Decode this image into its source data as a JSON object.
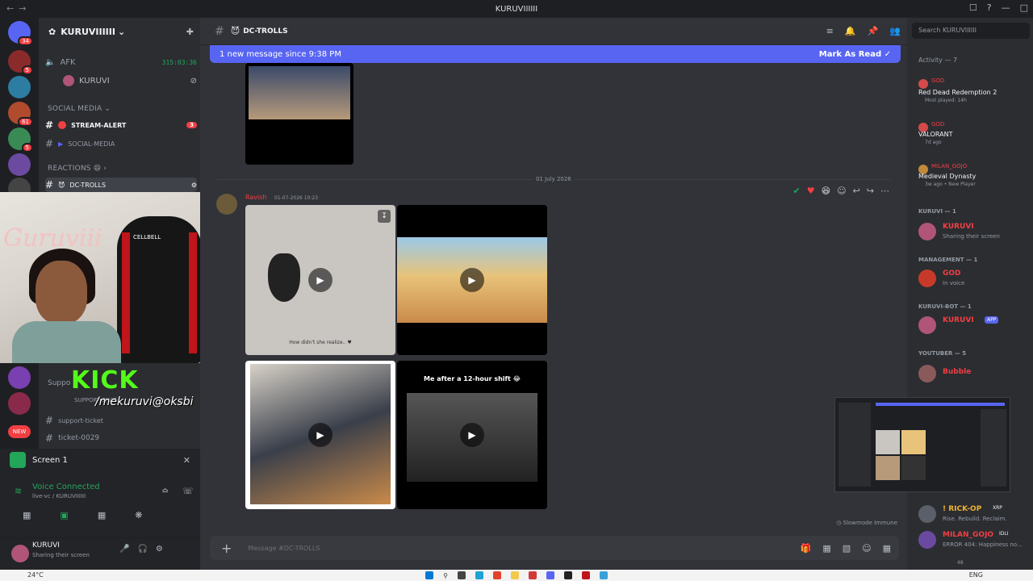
{
  "window": {
    "title": "KURUVIIIIII"
  },
  "guilds": {
    "badges": [
      "34",
      "5",
      "61",
      "5",
      "NEW"
    ]
  },
  "server": {
    "name": "KURUVIIIIII"
  },
  "channels": {
    "afk": {
      "name": "AFK",
      "timer": "315:03:36"
    },
    "voice_user": "KURUVI",
    "cat_social": "SOCIAL MEDIA",
    "stream_alert": "STREAM-ALERT",
    "stream_alert_badge": "3",
    "social_media": "SOCIAL-MEDIA",
    "cat_reactions": "REACTIONS",
    "dc_trolls": "DC-TROLLS",
    "support_cat": "Suppo",
    "support_chat": "SUPPORT-CHAT",
    "support_ticket": "support-ticket",
    "ticket": "ticket-0029"
  },
  "overlay": {
    "kick": "KICK",
    "kick_handle": "/mekuruvi@oksbi",
    "webcam_sign": "Guruviii",
    "chair_brand": "CELLBELL"
  },
  "voice": {
    "screen_label": "Screen 1",
    "status": "Voice Connected",
    "channel": "live-vc / KURUVIIIIII"
  },
  "user": {
    "name": "KURUVI",
    "status": "Sharing their screen"
  },
  "chat": {
    "channel": "DC-TROLLS",
    "banner_text": "1 new message since 9:38 PM",
    "mark_read": "Mark As Read",
    "date_divider": "01 July 2026",
    "author": "Ravish",
    "timestamp": "01-07-2026 10:23",
    "caption1": "How didn't she realize.. ♥",
    "caption4": "Me after a 12-hour shift 😂",
    "slowmode": "Slowmode Immune",
    "composer_placeholder": "Message #DC-TROLLS"
  },
  "members": {
    "search_placeholder": "Search KURUVIIIIII",
    "activity_header": "Activity — 7",
    "activities": [
      {
        "user": "GOD",
        "game": "Red Dead Redemption 2",
        "detail": "Most played: 14h"
      },
      {
        "user": "GOD",
        "game": "VALORANT",
        "detail": "7d ago"
      },
      {
        "user": "MILAN_GOJO",
        "game": "Medieval Dynasty",
        "detail": "3w ago • New Player"
      }
    ],
    "groups": [
      {
        "header": "KURUVI — 1",
        "name": "KURUVI",
        "sub": "Sharing their screen"
      },
      {
        "header": "MANAGEMENT — 1",
        "name": "GOD",
        "sub": "In voice"
      },
      {
        "header": "KURUVI-BOT — 1",
        "name": "KURUVI",
        "sub": "",
        "tag": "APP"
      },
      {
        "header": "YOUTUBER — 5",
        "name": "Bubble",
        "sub": ""
      }
    ],
    "bottom": [
      {
        "name": "! RICK-OP",
        "tag": "XRP",
        "sub": "Rise. Rebuild. Reclaim."
      },
      {
        "name": "MILAN_GOJO",
        "tag": "IDLI",
        "sub": "ERROR 404: Happiness no..."
      }
    ],
    "bottom_count": "48"
  },
  "taskbar": {
    "weather": "24°C",
    "lang": "ENG"
  },
  "colors": {
    "blurple": "#5865f2",
    "red": "#f23f43",
    "green": "#23a55a",
    "kick": "#53fc18"
  }
}
